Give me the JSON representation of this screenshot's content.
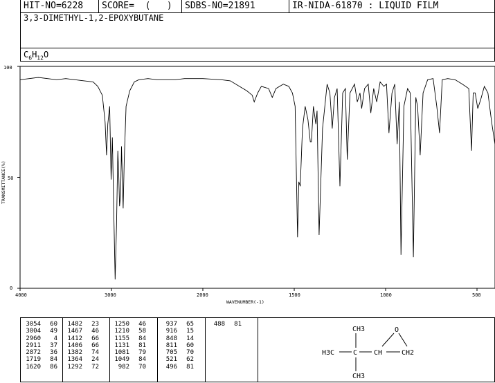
{
  "header": {
    "hit_no": "HIT-NO=6228",
    "score": "SCORE=  (   )",
    "sdbs_no": "SDBS-NO=21891",
    "ir_info": "IR-NIDA-61870 : LIQUID FILM"
  },
  "compound_name": "3,3-DIMETHYL-1,2-EPOXYBUTANE",
  "formula": {
    "c": "C",
    "c_n": "6",
    "h": "H",
    "h_n": "12",
    "o": "O"
  },
  "chart_data": {
    "type": "line",
    "xlabel": "WAVENUMBER(-1)",
    "ylabel": "TRANSMITTANCE(%)",
    "x_ticks": [
      "4000",
      "3000",
      "2000",
      "1500",
      "1000",
      "500"
    ],
    "y_ticks": [
      "100",
      "50",
      "0"
    ],
    "xlim": [
      4000,
      400
    ],
    "ylim": [
      0,
      100
    ],
    "axis_note": "x axis compressed 2:1 below 2000 cm-1",
    "x": [
      4000,
      3900,
      3800,
      3700,
      3600,
      3500,
      3400,
      3300,
      3200,
      3150,
      3100,
      3070,
      3054,
      3040,
      3020,
      3004,
      2990,
      2975,
      2960,
      2945,
      2930,
      2920,
      2911,
      2900,
      2890,
      2880,
      2872,
      2860,
      2840,
      2800,
      2750,
      2700,
      2600,
      2500,
      2400,
      2300,
      2200,
      2100,
      2000,
      1900,
      1850,
      1800,
      1760,
      1730,
      1719,
      1700,
      1680,
      1640,
      1620,
      1600,
      1560,
      1530,
      1510,
      1495,
      1482,
      1475,
      1467,
      1455,
      1440,
      1425,
      1412,
      1406,
      1395,
      1382,
      1375,
      1364,
      1345,
      1320,
      1305,
      1292,
      1280,
      1265,
      1250,
      1235,
      1220,
      1210,
      1195,
      1170,
      1155,
      1140,
      1131,
      1115,
      1095,
      1081,
      1065,
      1049,
      1030,
      1010,
      995,
      982,
      965,
      950,
      937,
      925,
      916,
      900,
      880,
      865,
      848,
      835,
      825,
      811,
      795,
      770,
      740,
      720,
      705,
      690,
      660,
      620,
      580,
      545,
      530,
      521,
      510,
      496,
      480,
      460,
      440,
      420,
      400
    ],
    "y": [
      94,
      94.5,
      95,
      94.5,
      94,
      94.5,
      94,
      93.5,
      93,
      91,
      87,
      75,
      60,
      74,
      82,
      49,
      68,
      35,
      4,
      28,
      62,
      50,
      37,
      42,
      64,
      48,
      36,
      58,
      82,
      89,
      93,
      94,
      94.5,
      94,
      94,
      94,
      94.5,
      94.5,
      94.5,
      94,
      93.5,
      91,
      89,
      87,
      84,
      88,
      91,
      90,
      86,
      90,
      92,
      91,
      88,
      82,
      23,
      48,
      46,
      72,
      82,
      76,
      66,
      66,
      82,
      74,
      80,
      24,
      72,
      92,
      88,
      72,
      86,
      90,
      46,
      88,
      90,
      58,
      88,
      92,
      84,
      88,
      81,
      90,
      92,
      79,
      90,
      84,
      93,
      91,
      92,
      70,
      88,
      92,
      65,
      84,
      15,
      82,
      90,
      88,
      14,
      86,
      82,
      60,
      88,
      94,
      94.5,
      82,
      70,
      94,
      94.5,
      94,
      92,
      90,
      62,
      88,
      88,
      81,
      85,
      91,
      88,
      75,
      64
    ]
  },
  "peak_table": {
    "columns": [
      [
        [
          "3054",
          "60"
        ],
        [
          "3004",
          "49"
        ],
        [
          "2960",
          "4"
        ],
        [
          "2911",
          "37"
        ],
        [
          "2872",
          "36"
        ],
        [
          "1719",
          "84"
        ],
        [
          "1620",
          "86"
        ]
      ],
      [
        [
          "1482",
          "23"
        ],
        [
          "1467",
          "46"
        ],
        [
          "1412",
          "66"
        ],
        [
          "1406",
          "66"
        ],
        [
          "1382",
          "74"
        ],
        [
          "1364",
          "24"
        ],
        [
          "1292",
          "72"
        ]
      ],
      [
        [
          "1250",
          "46"
        ],
        [
          "1210",
          "58"
        ],
        [
          "1155",
          "84"
        ],
        [
          "1131",
          "81"
        ],
        [
          "1081",
          "79"
        ],
        [
          "1049",
          "84"
        ],
        [
          "982",
          "70"
        ]
      ],
      [
        [
          "937",
          "65"
        ],
        [
          "916",
          "15"
        ],
        [
          "848",
          "14"
        ],
        [
          "811",
          "60"
        ],
        [
          "705",
          "70"
        ],
        [
          "521",
          "62"
        ],
        [
          "496",
          "81"
        ]
      ],
      [
        [
          "488",
          "81"
        ]
      ]
    ]
  },
  "structure": {
    "ch3_top": "CH3",
    "h3c_left": "H3C",
    "ch": "CH",
    "ch2": "CH2",
    "o": "O",
    "ch3_bottom": "CH3"
  }
}
